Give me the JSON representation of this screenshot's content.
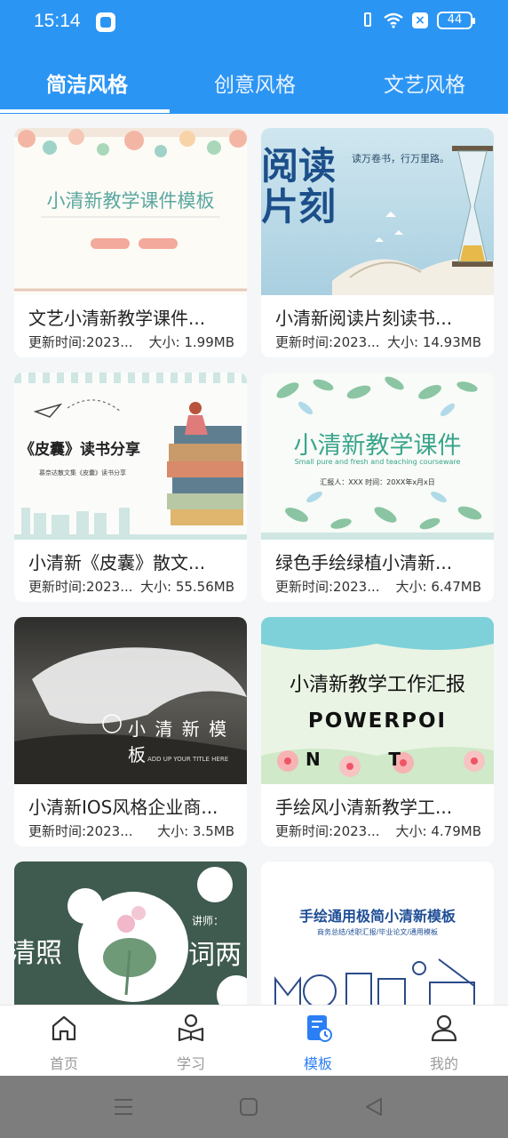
{
  "status": {
    "time": "15:14",
    "battery": "44"
  },
  "tabs": [
    {
      "label": "简洁风格",
      "active": true
    },
    {
      "label": "创意风格",
      "active": false
    },
    {
      "label": "文艺风格",
      "active": false
    }
  ],
  "cards": [
    {
      "title": "文艺小清新教学课件...",
      "date": "更新时间:2023...",
      "size": "大小: 1.99MB",
      "thumb_text": "小清新教学课件模板"
    },
    {
      "title": "小清新阅读片刻读书...",
      "date": "更新时间:2023...",
      "size": "大小: 14.93MB",
      "thumb_text": "阅读片刻",
      "thumb_sub": "读万卷书，行万里路。"
    },
    {
      "title": "小清新《皮囊》散文...",
      "date": "更新时间:2023...",
      "size": "大小: 55.56MB",
      "thumb_text": "《皮囊》读书分享",
      "thumb_sub": "慕奈达散文集《皮囊》读书分享"
    },
    {
      "title": "绿色手绘绿植小清新...",
      "date": "更新时间:2023...",
      "size": "大小: 6.47MB",
      "thumb_text": "小清新教学课件",
      "thumb_sub": "Small pure and fresh and teaching courseware",
      "thumb_sub2": "汇报人：XXX    时间：20XX年x月x日"
    },
    {
      "title": "小清新IOS风格企业商...",
      "date": "更新时间:2023...",
      "size": "大小: 3.5MB",
      "thumb_text": "小 清 新 模 板",
      "thumb_sub": "ADD UP YOUR TITLE HERE"
    },
    {
      "title": "手绘风小清新教学工...",
      "date": "更新时间:2023...",
      "size": "大小: 4.79MB",
      "thumb_text": "小清新教学工作汇报",
      "thumb_sub": "POWERPOI",
      "thumb_sub2": "N           T"
    },
    {
      "title": "",
      "date": "",
      "size": "",
      "thumb_text": "清照",
      "thumb_sub": "词两",
      "thumb_sub2": "讲师："
    },
    {
      "title": "",
      "date": "",
      "size": "",
      "thumb_text": "手绘通用极简小清新模板",
      "thumb_sub": "商务总结/述职汇报/毕业论文/通用模板"
    }
  ],
  "nav": [
    {
      "label": "首页",
      "icon": "home-icon",
      "active": false
    },
    {
      "label": "学习",
      "icon": "study-icon",
      "active": false
    },
    {
      "label": "模板",
      "icon": "template-icon",
      "active": true
    },
    {
      "label": "我的",
      "icon": "profile-icon",
      "active": false
    }
  ],
  "colors": {
    "primary": "#2b95f4",
    "nav_active": "#2b7ff4",
    "background": "#f4f6f8"
  }
}
